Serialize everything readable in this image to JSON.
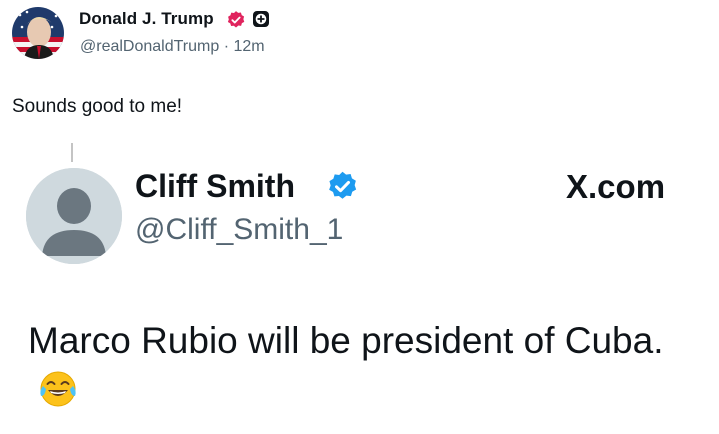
{
  "post": {
    "author_name": "Donald J. Trump",
    "handle": "@realDonaldTrump",
    "separator": "·",
    "time_ago": "12m",
    "text": "Sounds good to me!"
  },
  "quoted": {
    "author_name": "Cliff Smith",
    "handle": "@Cliff_Smith_1",
    "source_label": "X.com",
    "text": "Marco Rubio will be president of Cuba.",
    "emoji_name": "face-with-tears-of-joy"
  },
  "colors": {
    "text": "#0f1419",
    "secondary_text": "#536471",
    "verified_pink": "#e0245e",
    "verified_blue": "#1d9bf0",
    "avatar_placeholder": "#cfd9de",
    "avatar_silhouette": "#6b7780"
  }
}
